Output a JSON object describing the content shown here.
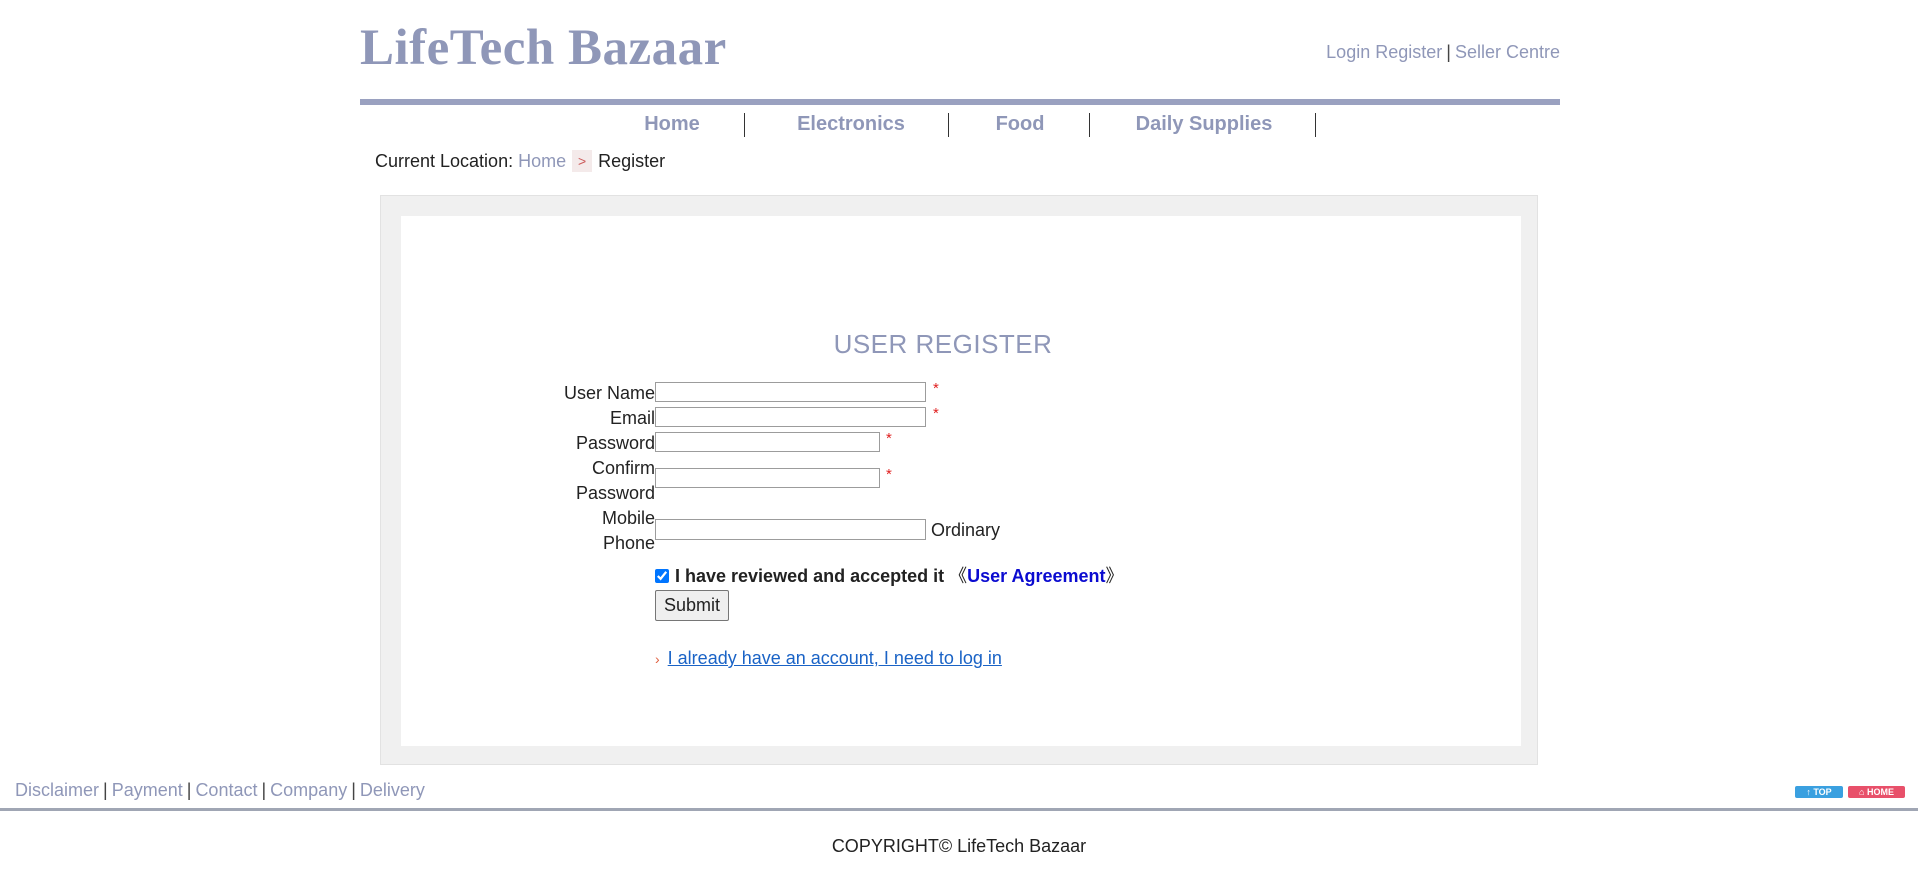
{
  "header": {
    "logo": "LifeTech Bazaar",
    "login": "Login",
    "register": "Register",
    "separator": "|",
    "seller_centre": "Seller Centre"
  },
  "nav": {
    "items": [
      {
        "label": "Home"
      },
      {
        "label": "Electronics"
      },
      {
        "label": "Food"
      },
      {
        "label": "Daily Supplies"
      }
    ]
  },
  "breadcrumb": {
    "prefix": "Current Location:",
    "home": "Home",
    "arrow": ">",
    "current": "Register"
  },
  "form": {
    "title": "USER REGISTER",
    "fields": {
      "username_label": "User Name",
      "email_label": "Email",
      "password_label": "Password",
      "confirm_label_1": "Confirm",
      "confirm_label_2": "Password",
      "mobile_label_1": "Mobile",
      "mobile_label_2": "Phone",
      "required_mark": "*",
      "mobile_hint": "Ordinary"
    },
    "agree_text": "I have reviewed and accepted it",
    "agree_open": "《",
    "agree_link": "User Agreement",
    "agree_close": "》",
    "agree_checked": true,
    "submit_label": "Submit",
    "login_arrow": "›",
    "login_link": "I already have an account, I need to log in"
  },
  "footer": {
    "links": [
      "Disclaimer",
      "Payment",
      "Contact",
      "Company",
      "Delivery"
    ],
    "separator": "|",
    "copyright": "COPYRIGHT© LifeTech Bazaar",
    "top_badge": "↑ TOP",
    "home_badge": "⌂ HOME"
  },
  "colors": {
    "brand": "#8f97b8",
    "required": "#e02020",
    "agreement_link": "#0b0bd0",
    "login_link": "#1a63c6",
    "top_badge": "#3aa0e0",
    "home_badge": "#e8506a"
  }
}
